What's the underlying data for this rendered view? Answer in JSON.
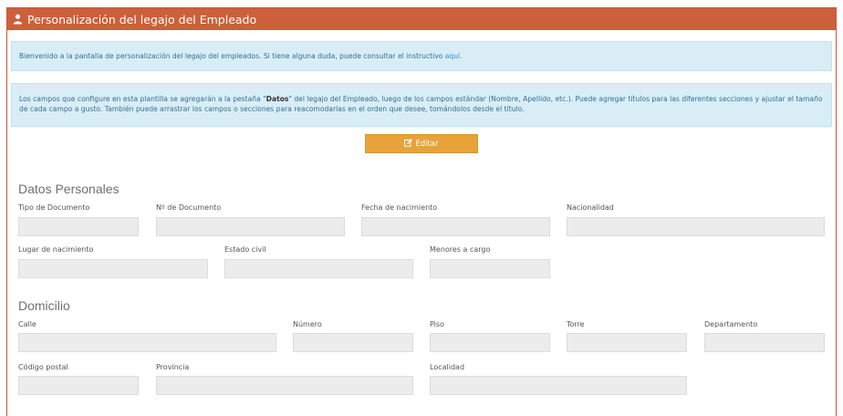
{
  "header": {
    "title": "Personalización del legajo del Empleado",
    "icon": "user-icon"
  },
  "info1": {
    "text": "Bienvenido a la pantalla de personalización del legajo del empleados. Si tiene alguna duda, puede consultar el instructivo ",
    "link": "aquí."
  },
  "info2": {
    "before": "Los campos que configure en esta plantilla se agregarán a la pestaña \"",
    "bold": "Datos",
    "after": "\" del legajo del Empleado, luego de los campos estándar (Nombre, Apellido, etc.). Puede agregar títulos para las diferentes secciones y ajustar el tamaño de cada campo a gusto. También puede arrastrar los campos o secciones para reacomodarlas en el orden que desee, tomándolos desde el título."
  },
  "edit_button": {
    "label": "Editar",
    "icon": "edit-icon"
  },
  "sections": {
    "personal": {
      "title": "Datos Personales",
      "fields": {
        "tipo_documento": "Tipo de Documento",
        "nro_documento": "Nº de Documento",
        "fecha_nacimiento": "Fecha de nacimiento",
        "nacionalidad": "Nacionalidad",
        "lugar_nacimiento": "Lugar de nacimiento",
        "estado_civil": "Estado civil",
        "menores_cargo": "Menores a cargo"
      }
    },
    "domicilio": {
      "title": "Domicilio",
      "fields": {
        "calle": "Calle",
        "numero": "Número",
        "piso": "Piso",
        "torre": "Torre",
        "departamento": "Departamento",
        "codigo_postal": "Código postal",
        "provincia": "Provincia",
        "localidad": "Localidad"
      }
    }
  },
  "colors": {
    "header": "#cc5f3c",
    "button": "#e7a23a",
    "alert_bg": "#d9edf7",
    "field_bg": "#ececec"
  }
}
